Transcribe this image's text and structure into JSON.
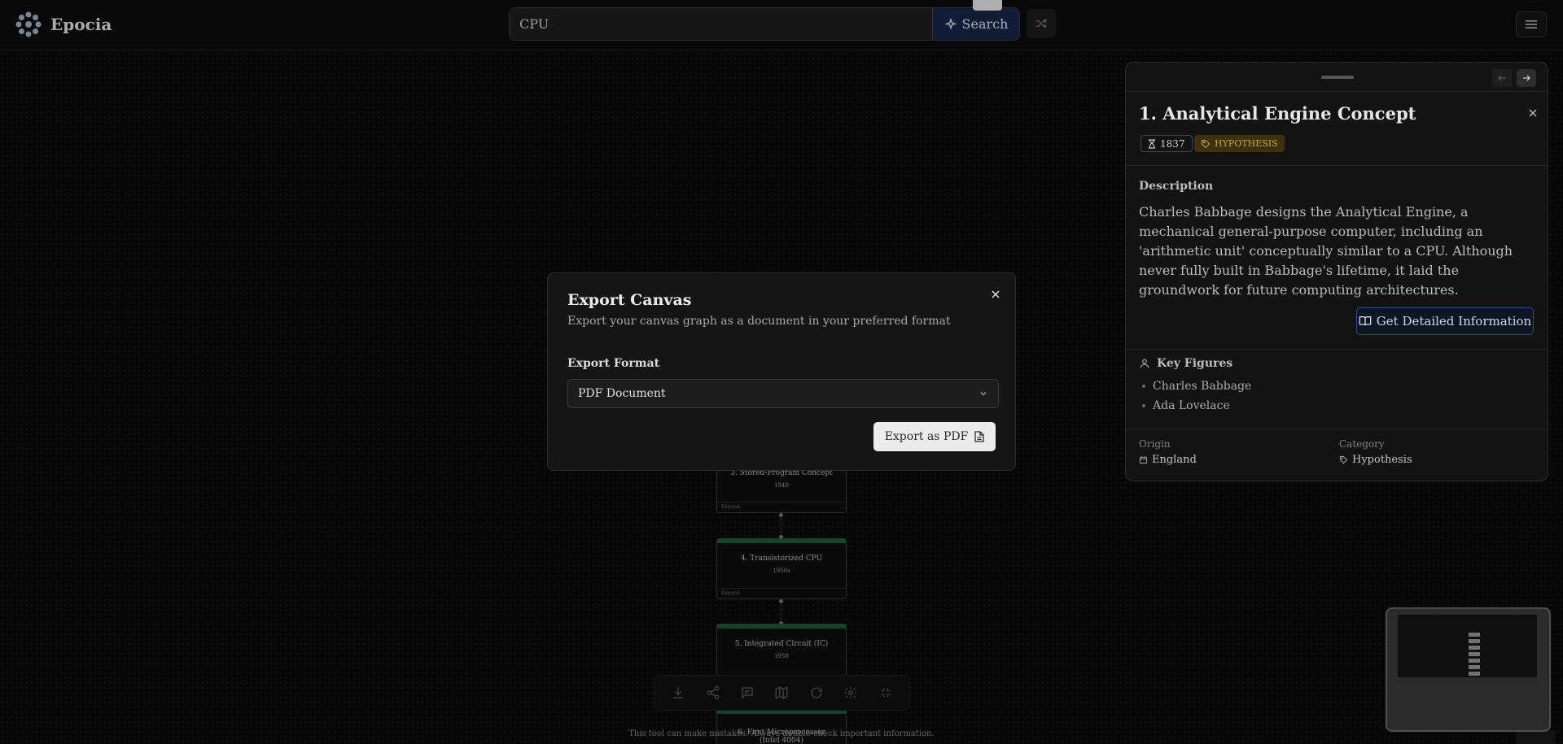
{
  "header": {
    "logo_text": "Epocia",
    "search_value": "CPU",
    "search_button": "Search"
  },
  "canvas": {
    "nodes": [
      {
        "title": "3. Stored-Program Concept",
        "year": "1949",
        "footer": "Expand"
      },
      {
        "title": "4. Transistorized CPU",
        "year": "1950s",
        "footer": "Expand"
      },
      {
        "title": "5. Integrated Circuit (IC)",
        "year": "1958",
        "footer": ""
      },
      {
        "title": "6. First Microprocessor (Intel 4004)",
        "year": "",
        "footer": ""
      }
    ]
  },
  "disclaimer": "This tool can make mistakes. Always double-check important information.",
  "panel": {
    "title": "1. Analytical Engine Concept",
    "year": "1837",
    "tag": "HYPOTHESIS",
    "description_label": "Description",
    "description": "Charles Babbage designs the Analytical Engine, a mechanical general-purpose computer, including an 'arithmetic unit' conceptually similar to a CPU. Although never fully built in Babbage's lifetime, it laid the groundwork for future computing architectures.",
    "detail_button": "Get Detailed Information",
    "key_figures_label": "Key Figures",
    "key_figures": [
      "Charles Babbage",
      "Ada Lovelace"
    ],
    "origin_label": "Origin",
    "origin": "England",
    "category_label": "Category",
    "category": "Hypothesis"
  },
  "modal": {
    "title": "Export Canvas",
    "subtitle": "Export your canvas graph as a document in your preferred format",
    "format_label": "Export Format",
    "format_value": "PDF Document",
    "export_button": "Export as PDF"
  },
  "colors": {
    "accent_blue": "#2c4e86",
    "hypothesis_badge": "#c9a23a",
    "node_green": "#1d5a35"
  }
}
